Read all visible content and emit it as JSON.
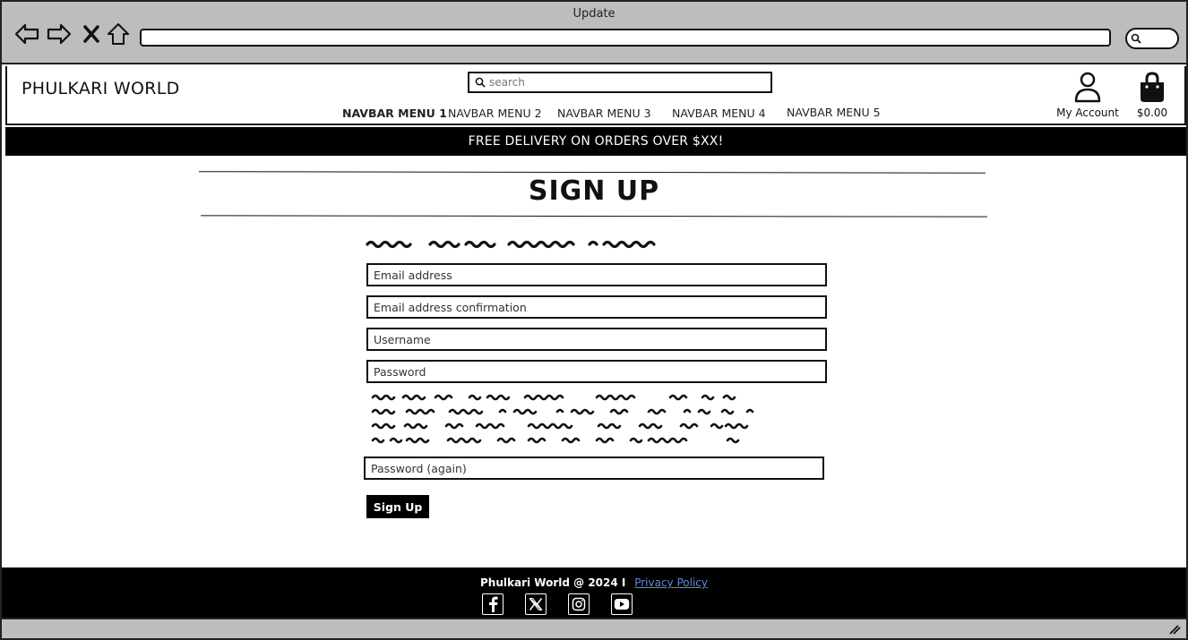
{
  "browser": {
    "title": "Update"
  },
  "header": {
    "logo": "PHULKARI WORLD",
    "search_placeholder": "search",
    "nav": [
      "NAVBAR MENU 1",
      "NAVBAR MENU 2",
      "NAVBAR MENU 3",
      "NAVBAR MENU 4",
      "NAVBAR MENU 5"
    ],
    "account_label": "My Account",
    "cart_total": "$0.00"
  },
  "banner": {
    "text": "FREE DELIVERY ON ORDERS OVER $XX!"
  },
  "main": {
    "title": "SIGN UP",
    "fields": {
      "email": "Email address",
      "email_confirm": "Email address confirmation",
      "username": "Username",
      "password": "Password",
      "password_again": "Password (again)"
    },
    "submit_label": "Sign Up"
  },
  "footer": {
    "copyright": "Phulkari World @ 2024 I",
    "privacy": "Privacy Policy",
    "socials": [
      "facebook-icon",
      "x-icon",
      "instagram-icon",
      "youtube-icon"
    ]
  },
  "colors": {
    "chrome": "#bdbdbd",
    "banner": "#000000",
    "link": "#5b8fd6"
  }
}
